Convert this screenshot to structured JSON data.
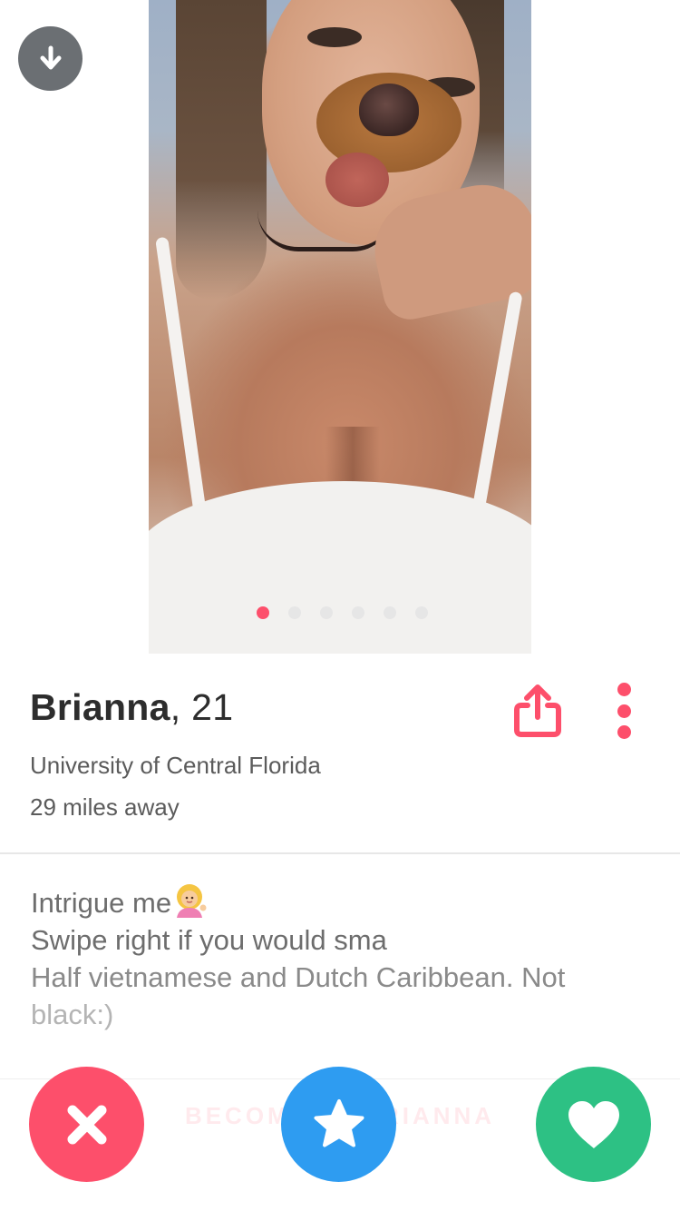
{
  "profile": {
    "name": "Brianna",
    "age": "21",
    "school": "University of Central Florida",
    "distance": "29 miles away",
    "photo_count": 6,
    "active_photo_index": 0
  },
  "bio": {
    "line1": "Intrigue me",
    "line2": "Swipe right if you would sma",
    "line3": "Half vietnamese and Dutch Caribbean. Not",
    "line4": "black:)"
  },
  "faded_section_label": "BECOME ... BRIANNA",
  "icons": {
    "collapse": "arrow-down-icon",
    "share": "share-icon",
    "more": "more-vertical-icon",
    "nope": "x-icon",
    "super_like": "star-icon",
    "like": "heart-icon",
    "bio_emoji": "woman-tipping-hand-emoji"
  },
  "colors": {
    "accent": "#fd4f6b",
    "nope": "#fd4f6b",
    "super_like": "#2e9cf1",
    "like": "#2dc184",
    "collapse_bg": "#6b6f73"
  }
}
